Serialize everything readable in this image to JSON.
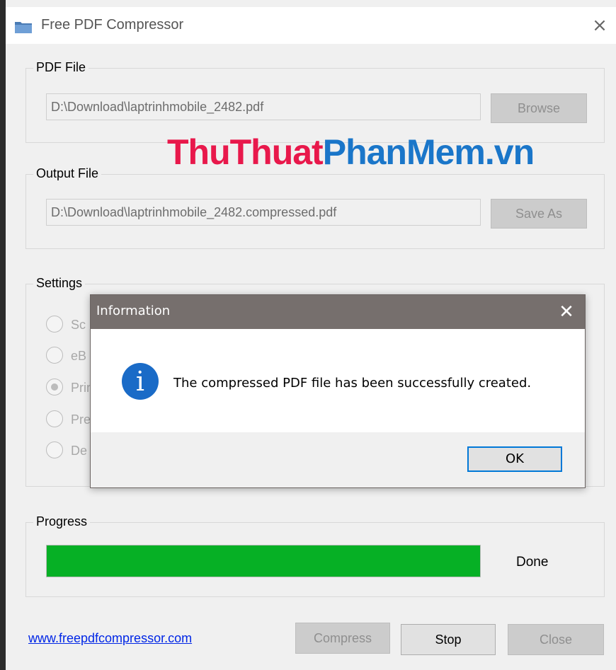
{
  "window": {
    "title": "Free PDF Compressor",
    "close_icon": "×"
  },
  "pdf_file": {
    "label": "PDF File",
    "value": "D:\\Download\\laptrinhmobile_2482.pdf",
    "browse_label": "Browse"
  },
  "output_file": {
    "label": "Output File",
    "value": "D:\\Download\\laptrinhmobile_2482.compressed.pdf",
    "save_as_label": "Save As"
  },
  "settings": {
    "label": "Settings",
    "options": [
      {
        "label": "Sc",
        "checked": false
      },
      {
        "label": "eB",
        "checked": false
      },
      {
        "label": "Prin",
        "checked": true
      },
      {
        "label": "Pre",
        "checked": false
      },
      {
        "label": "De",
        "checked": false
      }
    ]
  },
  "watermark": {
    "part1": "ThuThuat",
    "part2": "PhanMem.vn"
  },
  "progress": {
    "label": "Progress",
    "percent": 100,
    "status": "Done"
  },
  "footer": {
    "link": "www.freepdfcompressor.com",
    "compress_label": "Compress",
    "stop_label": "Stop",
    "close_label": "Close"
  },
  "dialog": {
    "title": "Information",
    "close_icon": "✕",
    "icon": "i",
    "message": "The compressed PDF file has been successfully created.",
    "ok_label": "OK"
  },
  "colors": {
    "progress_fill": "#06b025",
    "dialog_titlebar": "#766f6d",
    "info_icon": "#1a6bc7",
    "link": "#0026e6"
  }
}
